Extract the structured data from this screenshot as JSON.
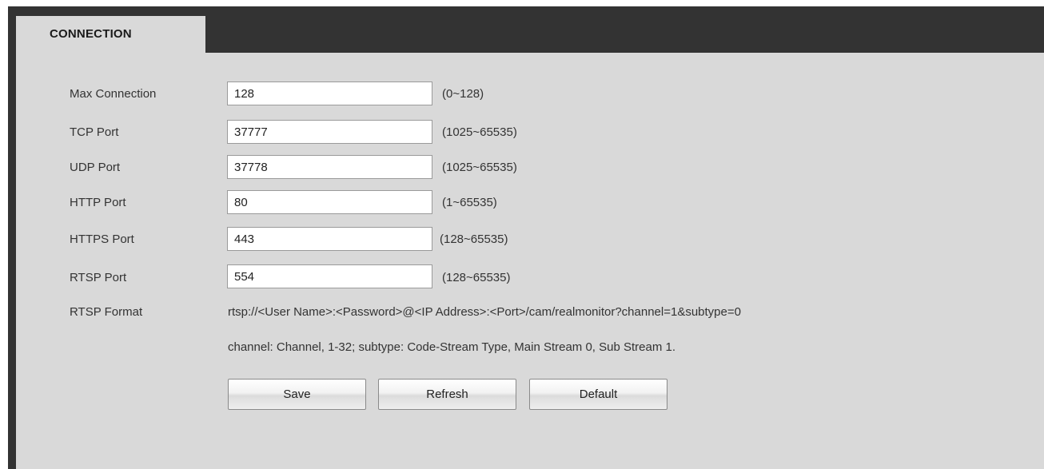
{
  "tab": {
    "title": "CONNECTION"
  },
  "fields": [
    {
      "label": "Max Connection",
      "value": "128",
      "range": "(0~128)"
    },
    {
      "label": "TCP Port",
      "value": "37777",
      "range": "(1025~65535)"
    },
    {
      "label": "UDP Port",
      "value": "37778",
      "range": "(1025~65535)"
    },
    {
      "label": "HTTP Port",
      "value": "80",
      "range": "(1~65535)"
    },
    {
      "label": "HTTPS Port",
      "value": "443",
      "range": "(128~65535)"
    },
    {
      "label": "RTSP Port",
      "value": "554",
      "range": "(128~65535)"
    }
  ],
  "rtsp": {
    "label": "RTSP Format",
    "format": "rtsp://<User Name>:<Password>@<IP Address>:<Port>/cam/realmonitor?channel=1&subtype=0",
    "note": "channel: Channel, 1-32; subtype: Code-Stream Type, Main Stream 0, Sub Stream 1."
  },
  "buttons": {
    "save": "Save",
    "refresh": "Refresh",
    "default": "Default"
  }
}
